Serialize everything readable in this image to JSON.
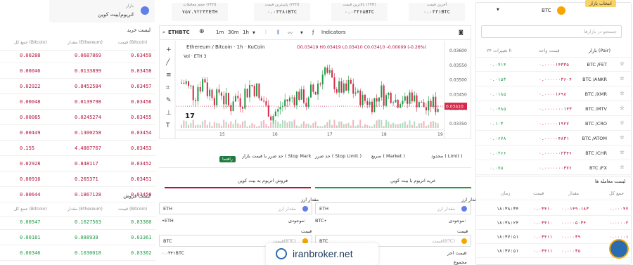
{
  "colors": {
    "buy": "#1d9b46",
    "sell": "#b3123a",
    "accent": "#f7a600",
    "primary": "#2b6cb0"
  },
  "header": {
    "market_label": "بازار",
    "market_name": "اتریوم/بیت کوین",
    "stats": [
      {
        "label": "آخرین قیمت",
        "value": "۰.۰۳۴۱BTC"
      },
      {
        "label": "بالاترین قیمت (۲۴H)",
        "value": "۰.۰۳۴۶۵BTC"
      },
      {
        "label": "پایینترین قیمت (۲۴H)",
        "value": "۰.۰۳۳۸۱BTC"
      },
      {
        "label": "حجم معاملات (۲۴H)",
        "value": "۷۵۷.۷۲۲۳۳ETH"
      }
    ]
  },
  "orderbook": {
    "buy_title": "لیست خرید",
    "sell_title": "لیست فروش",
    "col_total": "جمع کل (Bitcoin)",
    "col_amount": "مقدار (Ethereum)",
    "col_price": "قیمت (Bitcoin)",
    "buy_rows": [
      {
        "total": "0.00288",
        "amount": "0.0687869",
        "price": "0.03459"
      },
      {
        "total": "0.00046",
        "amount": "0.0133899",
        "price": "0.03458"
      },
      {
        "total": "0.02922",
        "amount": "0.8452584",
        "price": "0.03457"
      },
      {
        "total": "0.00048",
        "amount": "0.0139798",
        "price": "0.03456"
      },
      {
        "total": "0.00085",
        "amount": "0.0245274",
        "price": "0.03455"
      },
      {
        "total": "0.00449",
        "amount": "0.1300258",
        "price": "0.03454"
      },
      {
        "total": "0.155",
        "amount": "4.4887767",
        "price": "0.03453"
      },
      {
        "total": "0.02928",
        "amount": "0.848117",
        "price": "0.03452"
      },
      {
        "total": "0.00916",
        "amount": "0.265371",
        "price": "0.03451"
      },
      {
        "total": "0.00644",
        "amount": "0.1867128",
        "price": "0.03450"
      }
    ],
    "sell_rows": [
      {
        "total": "0.00547",
        "amount": "0.1627563",
        "price": "0.03360"
      },
      {
        "total": "0.00181",
        "amount": "0.088938",
        "price": "0.03361"
      },
      {
        "total": "0.00346",
        "amount": "0.1030018",
        "price": "0.03362"
      }
    ]
  },
  "chart": {
    "symbol": "ETHBTC",
    "intervals": [
      "1m",
      "30m",
      "1h"
    ],
    "indicators": "Indicators",
    "legend_title": "Ethereum / Bitcoin · 1h · KuCoin",
    "ohlc": "O0.03419 H0.03419 L0.03410 C0.03410 -0.00009 (-0.26%)",
    "vol": "Vol · ETH 3",
    "last_price": "0.03410",
    "y_ticks": [
      "0.03600",
      "0.03550",
      "0.03500",
      "0.03450",
      "0.03400",
      "0.03350"
    ],
    "x_ticks": [
      "15",
      "16",
      "17",
      "18",
      "19"
    ]
  },
  "trade": {
    "order_types": [
      "محدود ( Limit )",
      "سریع ( Market )",
      "حد ضرر ( Stop Limit )",
      "حد ضرر با قیمت بازار ( Stop Market )"
    ],
    "guide_label": "راهنما",
    "buy_tab": "خرید اتریوم با بیت کوین",
    "sell_tab": "فروش اتریوم به بیت کوین",
    "amount_label": "مقدار ارز",
    "amount_placeholder": "مقدار ارز",
    "price_label": "قیمت",
    "price_placeholder": "قیمت(BTC)",
    "balance_label": "موجودی:",
    "buy_balance": "BTC•",
    "sell_balance": "•ETH",
    "price_value_sell": "۰.۰۳۴۱BTC",
    "total_label": "قیمت اخر:",
    "sum_label": "مجموع",
    "watermark": "iranbroker.net"
  },
  "markets": {
    "title": "انتخاب بازار",
    "base": "BTC",
    "search_placeholder": "جستجو در بازارها",
    "col_pair": "بازار (Pair)",
    "col_price": "قیمت واحد",
    "col_change": "تغییرات ۲۴ h",
    "rows": [
      {
        "pair": "BTC /FET",
        "price": "۰.۰۰۰۰۱۴۳۳۵",
        "change": "۰.۰۷۱۴",
        "up": true
      },
      {
        "pair": "BTC /ANKR",
        "price": "۰.۰۰۰۰۰۰۳۶۰۴",
        "change": "۰.۰۱۵۳",
        "up": true
      },
      {
        "pair": "BTC /XMR",
        "price": "۰.۰۰۰۰۱۶۹۸",
        "change": "۰.۰۱۸۵",
        "up": true
      },
      {
        "pair": "BTC /MTV",
        "price": "۰.۰۰۰۰۰۰۰۱۴۳",
        "change": "۰.۰۴۸۵",
        "up": true
      },
      {
        "pair": "BTC /CRO",
        "price": "۰.۰۰۰۰۰۱۹۲۷",
        "change": "۰.۱۰۳",
        "up": true
      },
      {
        "pair": "BTC /ATOM",
        "price": "۰.۰۰۰۰۰۴۸۳۱",
        "change": "۰.۰۶۷۸",
        "up": true
      },
      {
        "pair": "BTC /CHR",
        "price": "۰.۰۰۰۰۰۰۲۳۴۶",
        "change": "۰.۰۲۶۶",
        "up": true
      },
      {
        "pair": "BTC /FX",
        "price": "۰.۰۰۰۰۰۰۰۳۷۶",
        "change": "۰.۰۷۵",
        "up": true
      }
    ]
  },
  "trades": {
    "title": "لیست معامله ها",
    "col_total": "جمع کل",
    "col_amount": "مقدار",
    "col_price": "قیمت",
    "col_time": "زمان",
    "rows": [
      {
        "total": "۰.۰۰۰۴۷",
        "amount": "۰.۰۱۴۹۰۱۸۳",
        "price": "۰.۰۳۴۱۰",
        "time": "۱۸:۳۸:۳۴"
      },
      {
        "total": "۰.۰۰۰۰۲",
        "amount": "۰.۰۰۰۵۰۳۴",
        "price": "۰.۰۳۴۱۰",
        "time": "۱۸:۳۸:۲۴"
      },
      {
        "total": "۰.۰۰۰۰۱",
        "amount": "۰.۰۰۰۳۹",
        "price": "۰.۰۳۴۱۱",
        "time": "۱۸:۳۷:۵۱"
      },
      {
        "total": "۰.۰۰۰۰۱",
        "amount": "۰.۰۰۰۳۵",
        "price": "۰.۰۳۴۱۱",
        "time": "۱۸:۳۷:۵۱"
      }
    ]
  }
}
